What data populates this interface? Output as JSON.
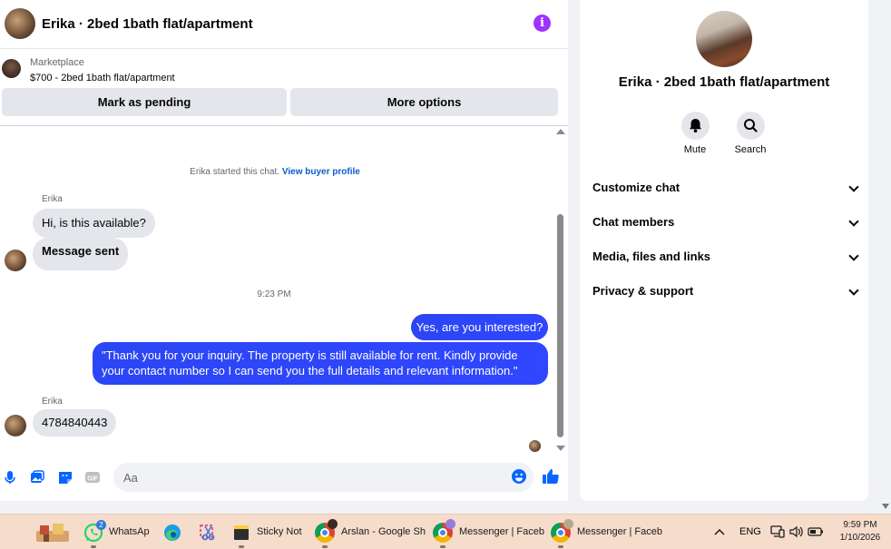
{
  "chat": {
    "title": "Erika · 2bed 1bath flat/apartment",
    "info_icon": "info-icon",
    "marketplace_label": "Marketplace",
    "listing": "$700 - 2bed 1bath flat/apartment",
    "mark_pending_label": "Mark as pending",
    "more_options_label": "More options"
  },
  "messages": {
    "started_text": "Erika started this chat.",
    "view_profile_link": "View buyer profile",
    "sender_name_1": "Erika",
    "incoming_1": "Hi, is this available?",
    "incoming_2": "Message sent",
    "timestamp": "9:23 PM",
    "outgoing_1": "Yes, are you interested?",
    "outgoing_2": "\"Thank you for your inquiry. The property is still available for rent. Kindly provide your contact number so I can send you the full details and relevant information.\"",
    "sender_name_2": "Erika",
    "incoming_3": "4784840443"
  },
  "composer": {
    "placeholder": "Aa",
    "icons": [
      "microphone-icon",
      "gallery-icon",
      "sticker-icon",
      "gif-icon",
      "emoji-icon",
      "thumbs-up-icon"
    ],
    "accent": "#0866ff"
  },
  "side": {
    "title": "Erika · 2bed 1bath flat/apartment",
    "mute_label": "Mute",
    "search_label": "Search",
    "rows": [
      "Customize chat",
      "Chat members",
      "Media, files and links",
      "Privacy & support"
    ]
  },
  "taskbar": {
    "whatsapp_label": "WhatsAp",
    "whatsapp_badge": "2",
    "sticky_label": "Sticky Note",
    "chrome1_label": "Arslan - Google Sh",
    "chrome2_label": "Messenger | Faceb",
    "chrome3_label": "Messenger | Faceb",
    "lang": "ENG",
    "time": "9:59 PM",
    "date": "1/10/2026"
  },
  "colors": {
    "outgoing_bubble": "#2b46f5",
    "info": "#a033ff",
    "link": "#0a5cc8",
    "taskbar": "#f6dccb"
  }
}
